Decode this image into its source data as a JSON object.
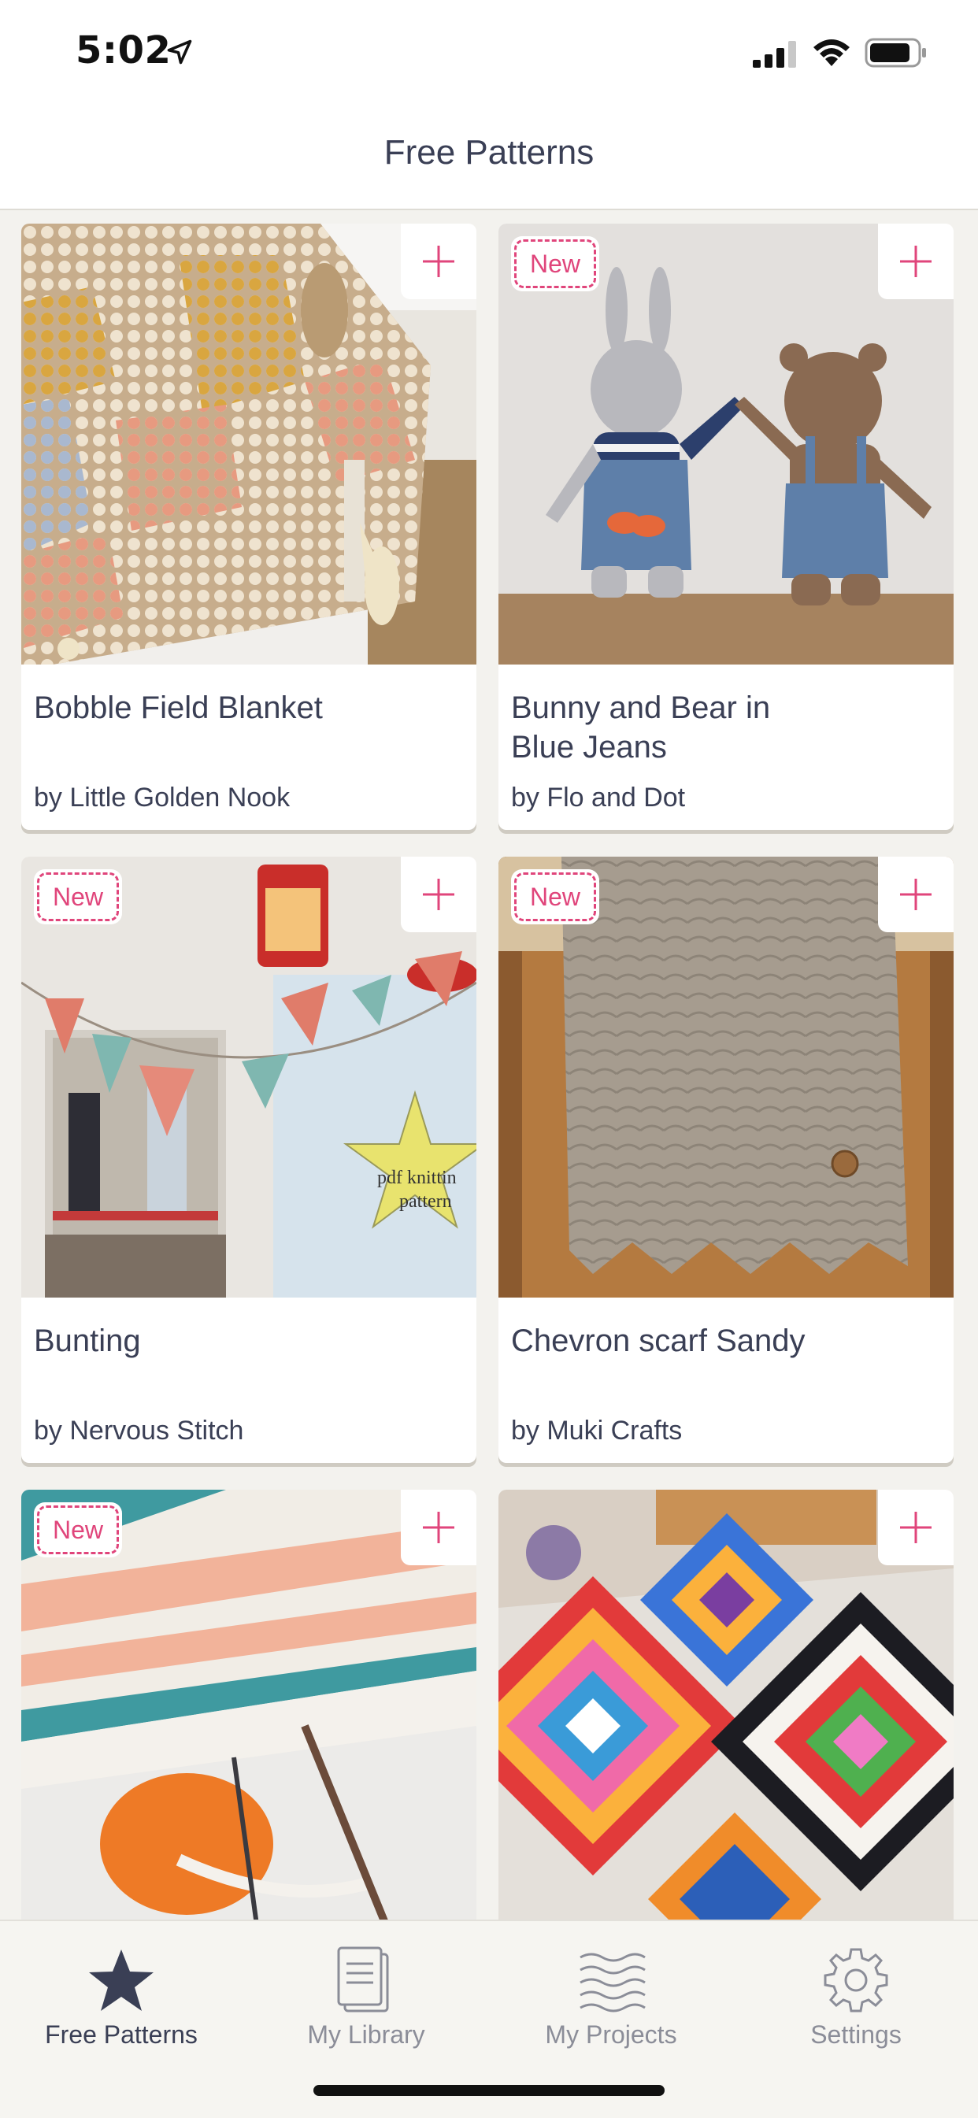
{
  "status_bar": {
    "time": "5:02"
  },
  "header": {
    "title": "Free Patterns"
  },
  "badge_label": "New",
  "colors": {
    "accent": "#e0457b",
    "text": "#3a3f55",
    "background": "#f3f2ee"
  },
  "patterns": [
    {
      "title": "Bobble Field Blanket",
      "author": "by Little Golden Nook",
      "is_new": false
    },
    {
      "title": "Bunny and Bear in Blue Jeans",
      "author": "by Flo and Dot",
      "is_new": true
    },
    {
      "title": "Bunting",
      "author": "by Nervous Stitch",
      "is_new": true,
      "image_text": "pdf knitting pattern"
    },
    {
      "title": "Chevron scarf Sandy",
      "author": "by Muki Crafts",
      "is_new": true
    },
    {
      "title": "",
      "author": "",
      "is_new": true
    },
    {
      "title": "",
      "author": "",
      "is_new": false
    }
  ],
  "tabs": [
    {
      "label": "Free Patterns",
      "icon": "star-icon",
      "active": true
    },
    {
      "label": "My Library",
      "icon": "library-icon",
      "active": false
    },
    {
      "label": "My Projects",
      "icon": "projects-icon",
      "active": false
    },
    {
      "label": "Settings",
      "icon": "gear-icon",
      "active": false
    }
  ]
}
